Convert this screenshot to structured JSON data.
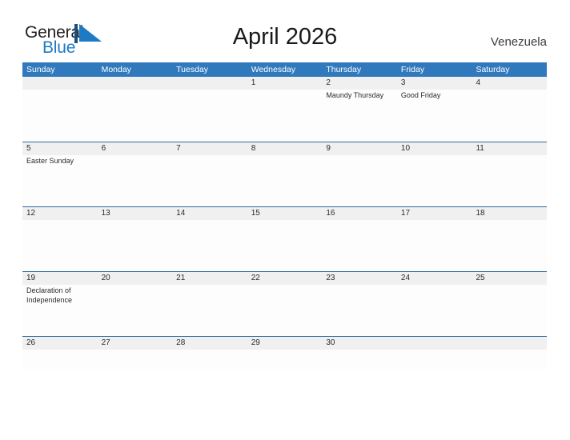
{
  "brand": {
    "name_part1": "General",
    "name_part2": "Blue",
    "mark": "flag-triangle-icon",
    "accent_color": "#1f7ac4"
  },
  "header": {
    "title": "April 2026",
    "country": "Venezuela"
  },
  "theme": {
    "header_blue": "#3179bd",
    "rule_blue": "#2e6da4",
    "date_strip_gray": "#f0f0f0",
    "body_white": "#fdfdfd",
    "text_dark": "#2b2b2b"
  },
  "calendar": {
    "weekday_headers": [
      "Sunday",
      "Monday",
      "Tuesday",
      "Wednesday",
      "Thursday",
      "Friday",
      "Saturday"
    ],
    "weeks": [
      {
        "days": [
          {
            "date": "",
            "events": []
          },
          {
            "date": "",
            "events": []
          },
          {
            "date": "",
            "events": []
          },
          {
            "date": "1",
            "events": []
          },
          {
            "date": "2",
            "events": [
              "Maundy Thursday"
            ]
          },
          {
            "date": "3",
            "events": [
              "Good Friday"
            ]
          },
          {
            "date": "4",
            "events": []
          }
        ]
      },
      {
        "days": [
          {
            "date": "5",
            "events": [
              "Easter Sunday"
            ]
          },
          {
            "date": "6",
            "events": []
          },
          {
            "date": "7",
            "events": []
          },
          {
            "date": "8",
            "events": []
          },
          {
            "date": "9",
            "events": []
          },
          {
            "date": "10",
            "events": []
          },
          {
            "date": "11",
            "events": []
          }
        ]
      },
      {
        "days": [
          {
            "date": "12",
            "events": []
          },
          {
            "date": "13",
            "events": []
          },
          {
            "date": "14",
            "events": []
          },
          {
            "date": "15",
            "events": []
          },
          {
            "date": "16",
            "events": []
          },
          {
            "date": "17",
            "events": []
          },
          {
            "date": "18",
            "events": []
          }
        ]
      },
      {
        "days": [
          {
            "date": "19",
            "events": [
              "Declaration of",
              "Independence"
            ]
          },
          {
            "date": "20",
            "events": []
          },
          {
            "date": "21",
            "events": []
          },
          {
            "date": "22",
            "events": []
          },
          {
            "date": "23",
            "events": []
          },
          {
            "date": "24",
            "events": []
          },
          {
            "date": "25",
            "events": []
          }
        ]
      },
      {
        "days": [
          {
            "date": "26",
            "events": []
          },
          {
            "date": "27",
            "events": []
          },
          {
            "date": "28",
            "events": []
          },
          {
            "date": "29",
            "events": []
          },
          {
            "date": "30",
            "events": []
          },
          {
            "date": "",
            "events": []
          },
          {
            "date": "",
            "events": []
          }
        ]
      }
    ]
  }
}
